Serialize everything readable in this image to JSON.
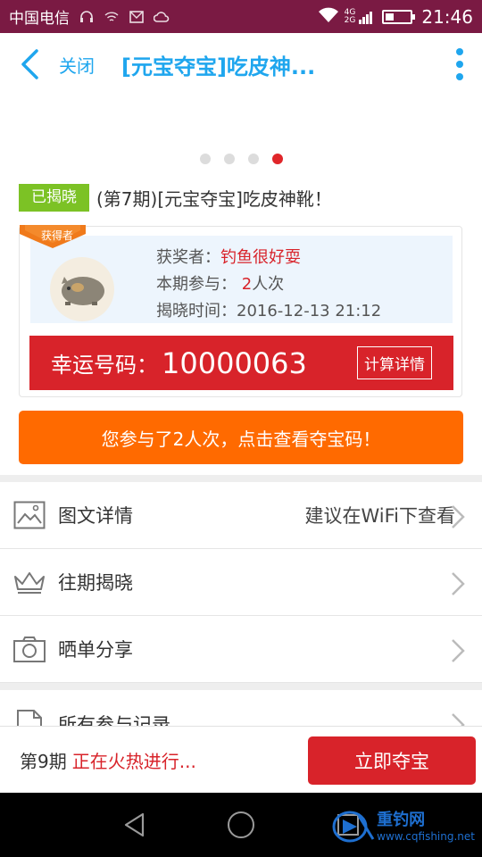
{
  "status_bar": {
    "carrier": "中国电信",
    "network_top": "4G",
    "network_bottom": "2G",
    "time": "21:46"
  },
  "header": {
    "close_label": "关闭",
    "title": "[元宝夺宝]吃皮神..."
  },
  "carousel": {
    "total": 4,
    "active_index": 3
  },
  "product": {
    "status_tag": "已揭晓",
    "name": "(第7期)[元宝夺宝]吃皮神靴！"
  },
  "winner": {
    "badge_label": "获得者",
    "winner_label": "获奖者：",
    "winner_name": "钓鱼很好耍",
    "participation_label": "本期参与：",
    "participation_count": "2",
    "participation_unit": "人次",
    "reveal_time_label": "揭晓时间：",
    "reveal_time": "2016-12-13 21:12"
  },
  "lucky_number": {
    "label": "幸运号码：",
    "value": "10000063",
    "calc_button": "计算详情"
  },
  "cta_button": "您参与了2人次，点击查看夺宝码！",
  "menu": [
    {
      "label": "图文详情",
      "hint": "建议在WiFi下查看",
      "icon": "image-icon"
    },
    {
      "label": "往期揭晓",
      "hint": "",
      "icon": "crown-icon"
    },
    {
      "label": "晒单分享",
      "hint": "",
      "icon": "camera-icon"
    },
    {
      "label": "所有参与记录",
      "hint": "",
      "icon": "document-icon"
    }
  ],
  "bottom_bar": {
    "period": "第9期",
    "status": "正在火热进行...",
    "buy_button": "立即夺宝"
  },
  "watermark": {
    "name": "重钓网",
    "url": "www.cqfishing.net"
  },
  "colors": {
    "accent_blue": "#1fa6ee",
    "red": "#d8232a",
    "orange": "#ff6a00",
    "green_tag": "#7cc225",
    "status_bar": "#7a1a43"
  }
}
